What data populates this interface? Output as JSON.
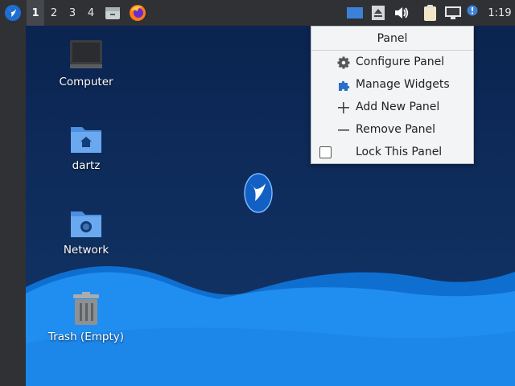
{
  "taskbar": {
    "workspaces": [
      "1",
      "2",
      "3",
      "4"
    ],
    "active_workspace": "1",
    "clock": "1:19",
    "icons": [
      "app-menu-icon",
      "file-manager-icon",
      "firefox-icon",
      "display-icon",
      "eject-icon",
      "volume-icon",
      "clipboard-icon",
      "network-icon",
      "notification-icon"
    ]
  },
  "desktop": {
    "icons": [
      {
        "label": "Computer",
        "icon": "computer-icon"
      },
      {
        "label": "dartz",
        "icon": "home-folder-icon"
      },
      {
        "label": "Network",
        "icon": "network-folder-icon"
      },
      {
        "label": "Trash (Empty)",
        "icon": "trash-icon"
      }
    ]
  },
  "context_menu": {
    "title": "Panel",
    "items": [
      {
        "label": "Configure Panel",
        "icon": "gear-icon"
      },
      {
        "label": "Manage Widgets",
        "icon": "puzzle-icon"
      },
      {
        "label": "Add New Panel",
        "icon": "plus-icon"
      },
      {
        "label": "Remove Panel",
        "icon": "minus-icon"
      },
      {
        "label": "Lock This Panel",
        "icon": "checkbox-icon",
        "checked": false
      }
    ]
  },
  "colors": {
    "taskbar": "#2f3134",
    "desktop_bg": "#0e2a55",
    "wave_light": "#1e8ff0",
    "wave_dark": "#0f6fd0",
    "accent": "#1565c0"
  }
}
